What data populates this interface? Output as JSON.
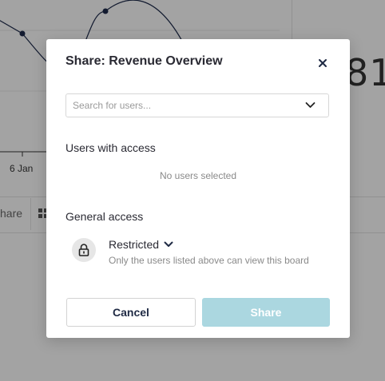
{
  "background": {
    "x_tick_label": "6 Jan",
    "big_number_fragment": "81",
    "toolbar_share_fragment": "hare"
  },
  "modal": {
    "title": "Share: Revenue Overview",
    "close_icon": "close-icon",
    "search": {
      "placeholder": "Search for users...",
      "value": "",
      "chevron_icon": "chevron-down-icon"
    },
    "users_with_access": {
      "heading": "Users with access",
      "empty_text": "No users selected"
    },
    "general_access": {
      "heading": "General access",
      "icon": "lock-icon",
      "level": "Restricted",
      "description": "Only the users listed above can view this board"
    },
    "buttons": {
      "cancel": "Cancel",
      "share": "Share"
    }
  },
  "colors": {
    "overlay": "rgba(0,0,0,0.34)",
    "share_button_disabled": "#abd7e0",
    "title_text": "#2a2a33",
    "cancel_text": "#1f2a44"
  }
}
